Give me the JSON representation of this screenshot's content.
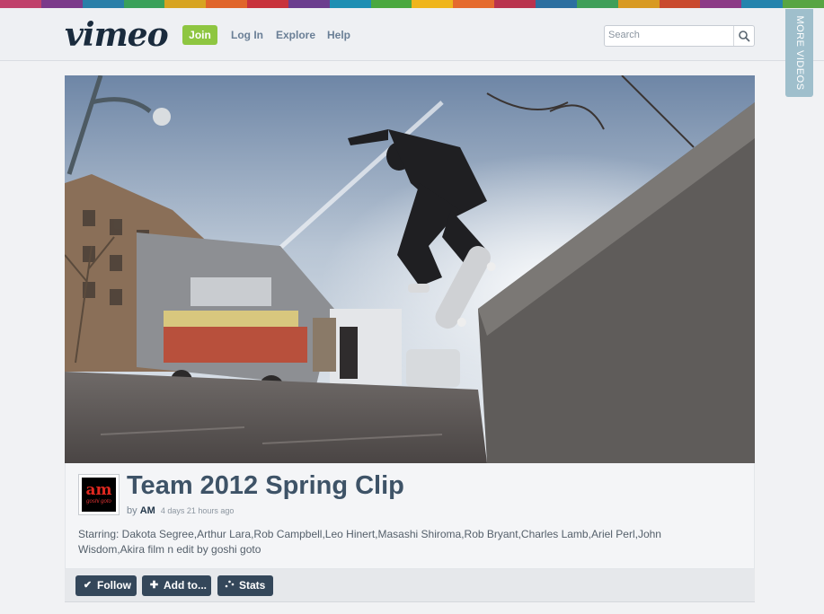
{
  "header": {
    "logo": "vimeo",
    "join_label": "Join",
    "nav": [
      "Log In",
      "Explore",
      "Help"
    ],
    "search": {
      "placeholder": "Search"
    },
    "stripe_colors": [
      "#c0416b",
      "#7b3a8a",
      "#2a7fa8",
      "#3aa15a",
      "#d7a421",
      "#e0652a",
      "#c8323c",
      "#6b3d8e",
      "#1e8fb3",
      "#4aa83f",
      "#efb51c",
      "#e56b2e",
      "#b9334e",
      "#2c6fa0",
      "#3f9f59",
      "#d89a22",
      "#c94a2e",
      "#8c3a86",
      "#2484ad",
      "#58a543"
    ]
  },
  "sidebar_tab": {
    "label": "MORE VIDEOS",
    "color": "#9fbfcc"
  },
  "video": {
    "title": "Team 2012 Spring Clip",
    "by_prefix": "by",
    "author": "AM",
    "posted": "4 days 21 hours ago",
    "description": "Starring: Dakota Segree,Arthur Lara,Rob Campbell,Leo Hinert,Masashi Shiroma,Rob Bryant,Charles Lamb,Ariel Perl,John Wisdom,Akira film n edit by goshi goto",
    "avatar_text": "am",
    "avatar_subtext": "goshi goto"
  },
  "actions": [
    {
      "label": "Follow",
      "icon": "check-icon"
    },
    {
      "label": "Add to...",
      "icon": "plus-icon"
    },
    {
      "label": "Stats",
      "icon": "stats-icon"
    }
  ],
  "colors": {
    "accent": "#8ec641",
    "button": "#34475a",
    "title": "#3e5367"
  }
}
